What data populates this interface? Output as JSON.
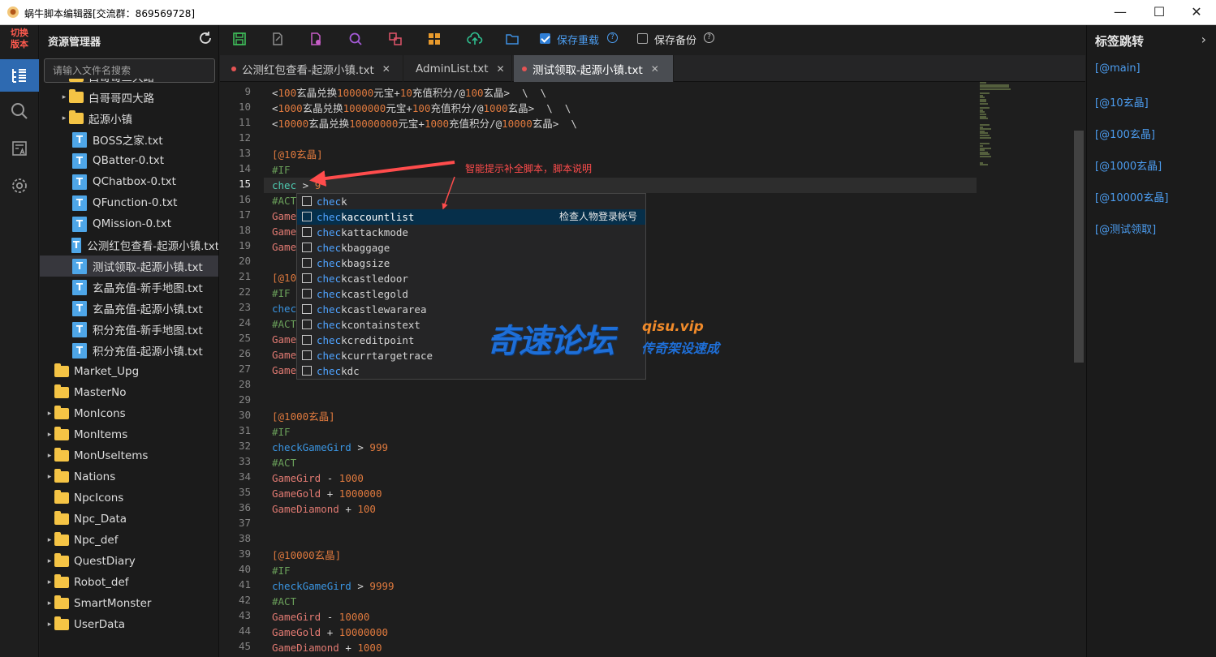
{
  "window": {
    "title": "蜗牛脚本编辑器[交流群：869569728]",
    "minimize": "—",
    "maximize": "☐",
    "close": "✕"
  },
  "activity": {
    "switch_label_1": "切换",
    "switch_label_2": "版本"
  },
  "sidebar": {
    "title": "资源管理器",
    "search_placeholder": "请输入文件名搜索",
    "tree": [
      {
        "label": "白哥哥三大路",
        "type": "folder",
        "arrow": "▸",
        "indent": 1
      },
      {
        "label": "白哥哥四大路",
        "type": "folder",
        "arrow": "▸",
        "indent": 1
      },
      {
        "label": "起源小镇",
        "type": "folder",
        "arrow": "▸",
        "indent": 1
      },
      {
        "label": "BOSS之家.txt",
        "type": "file",
        "arrow": "",
        "indent": 2
      },
      {
        "label": "QBatter-0.txt",
        "type": "file",
        "arrow": "",
        "indent": 2
      },
      {
        "label": "QChatbox-0.txt",
        "type": "file",
        "arrow": "",
        "indent": 2
      },
      {
        "label": "QFunction-0.txt",
        "type": "file",
        "arrow": "",
        "indent": 2
      },
      {
        "label": "QMission-0.txt",
        "type": "file",
        "arrow": "",
        "indent": 2
      },
      {
        "label": "公测红包查看-起源小镇.txt",
        "type": "file",
        "arrow": "",
        "indent": 2
      },
      {
        "label": "测试领取-起源小镇.txt",
        "type": "file",
        "arrow": "",
        "indent": 2,
        "selected": true
      },
      {
        "label": "玄晶充值-新手地图.txt",
        "type": "file",
        "arrow": "",
        "indent": 2
      },
      {
        "label": "玄晶充值-起源小镇.txt",
        "type": "file",
        "arrow": "",
        "indent": 2
      },
      {
        "label": "积分充值-新手地图.txt",
        "type": "file",
        "arrow": "",
        "indent": 2
      },
      {
        "label": "积分充值-起源小镇.txt",
        "type": "file",
        "arrow": "",
        "indent": 2
      },
      {
        "label": "Market_Upg",
        "type": "folder",
        "arrow": "",
        "indent": 0
      },
      {
        "label": "MasterNo",
        "type": "folder",
        "arrow": "",
        "indent": 0
      },
      {
        "label": "MonIcons",
        "type": "folder",
        "arrow": "▸",
        "indent": 0
      },
      {
        "label": "MonItems",
        "type": "folder",
        "arrow": "▸",
        "indent": 0
      },
      {
        "label": "MonUseItems",
        "type": "folder",
        "arrow": "▸",
        "indent": 0
      },
      {
        "label": "Nations",
        "type": "folder",
        "arrow": "▸",
        "indent": 0
      },
      {
        "label": "NpcIcons",
        "type": "folder",
        "arrow": "",
        "indent": 0
      },
      {
        "label": "Npc_Data",
        "type": "folder",
        "arrow": "",
        "indent": 0
      },
      {
        "label": "Npc_def",
        "type": "folder",
        "arrow": "▸",
        "indent": 0
      },
      {
        "label": "QuestDiary",
        "type": "folder",
        "arrow": "▸",
        "indent": 0
      },
      {
        "label": "Robot_def",
        "type": "folder",
        "arrow": "▸",
        "indent": 0
      },
      {
        "label": "SmartMonster",
        "type": "folder",
        "arrow": "▸",
        "indent": 0
      },
      {
        "label": "UserData",
        "type": "folder",
        "arrow": "▸",
        "indent": 0
      }
    ]
  },
  "toolbar": {
    "save_reload_label": "保存重载",
    "save_reload_checked": true,
    "save_backup_label": "保存备份",
    "save_backup_checked": false,
    "help_glyph": "?"
  },
  "tabs": [
    {
      "label": "公测红包查看-起源小镇.txt",
      "modified": true,
      "active": false,
      "close": "✕"
    },
    {
      "label": "AdminList.txt",
      "modified": false,
      "active": false,
      "close": "✕"
    },
    {
      "label": "测试领取-起源小镇.txt",
      "modified": true,
      "active": true,
      "close": "✕"
    }
  ],
  "editor": {
    "current_line": 15,
    "lines": [
      {
        "n": 9,
        "tokens": [
          [
            "w",
            "<"
          ],
          [
            "n",
            "100"
          ],
          [
            "w",
            "玄晶兑换"
          ],
          [
            "n",
            "100000"
          ],
          [
            "w",
            "元宝+"
          ],
          [
            "n",
            "10"
          ],
          [
            "w",
            "充值积分/@"
          ],
          [
            "n",
            "100"
          ],
          [
            "w",
            "玄晶>  \\  \\"
          ]
        ]
      },
      {
        "n": 10,
        "tokens": [
          [
            "w",
            "<"
          ],
          [
            "n",
            "1000"
          ],
          [
            "w",
            "玄晶兑换"
          ],
          [
            "n",
            "1000000"
          ],
          [
            "w",
            "元宝+"
          ],
          [
            "n",
            "100"
          ],
          [
            "w",
            "充值积分/@"
          ],
          [
            "n",
            "1000"
          ],
          [
            "w",
            "玄晶>  \\  \\"
          ]
        ]
      },
      {
        "n": 11,
        "tokens": [
          [
            "w",
            "<"
          ],
          [
            "n",
            "10000"
          ],
          [
            "w",
            "玄晶兑换"
          ],
          [
            "n",
            "10000000"
          ],
          [
            "w",
            "元宝+"
          ],
          [
            "n",
            "1000"
          ],
          [
            "w",
            "充值积分/@"
          ],
          [
            "n",
            "10000"
          ],
          [
            "w",
            "玄晶>  \\"
          ]
        ]
      },
      {
        "n": 12,
        "tokens": []
      },
      {
        "n": 13,
        "tokens": [
          [
            "lbl",
            "[@10玄晶]"
          ]
        ]
      },
      {
        "n": 14,
        "tokens": [
          [
            "kw",
            "#IF"
          ]
        ]
      },
      {
        "n": 15,
        "tokens": [
          [
            "typed",
            "chec"
          ],
          [
            "op",
            " > "
          ],
          [
            "n",
            "9"
          ]
        ]
      },
      {
        "n": 16,
        "tokens": [
          [
            "kw",
            "#ACT"
          ]
        ]
      },
      {
        "n": 17,
        "tokens": [
          [
            "var",
            "Game"
          ]
        ]
      },
      {
        "n": 18,
        "tokens": [
          [
            "var",
            "Game"
          ]
        ]
      },
      {
        "n": 19,
        "tokens": [
          [
            "var",
            "Game"
          ]
        ]
      },
      {
        "n": 20,
        "tokens": []
      },
      {
        "n": 21,
        "tokens": [
          [
            "lbl",
            "[@10"
          ]
        ]
      },
      {
        "n": 22,
        "tokens": [
          [
            "kw",
            "#IF"
          ]
        ]
      },
      {
        "n": 23,
        "tokens": [
          [
            "fn",
            "chec"
          ]
        ]
      },
      {
        "n": 24,
        "tokens": [
          [
            "kw",
            "#ACT"
          ]
        ]
      },
      {
        "n": 25,
        "tokens": [
          [
            "var",
            "Game"
          ]
        ]
      },
      {
        "n": 26,
        "tokens": [
          [
            "var",
            "Game"
          ]
        ]
      },
      {
        "n": 27,
        "tokens": [
          [
            "var",
            "Game"
          ]
        ]
      },
      {
        "n": 28,
        "tokens": []
      },
      {
        "n": 29,
        "tokens": []
      },
      {
        "n": 30,
        "tokens": [
          [
            "lbl",
            "[@1000玄晶]"
          ]
        ]
      },
      {
        "n": 31,
        "tokens": [
          [
            "kw",
            "#IF"
          ]
        ]
      },
      {
        "n": 32,
        "tokens": [
          [
            "fn",
            "checkGameGird"
          ],
          [
            "op",
            " > "
          ],
          [
            "n",
            "999"
          ]
        ]
      },
      {
        "n": 33,
        "tokens": [
          [
            "kw",
            "#ACT"
          ]
        ]
      },
      {
        "n": 34,
        "tokens": [
          [
            "var",
            "GameGird"
          ],
          [
            "op",
            " - "
          ],
          [
            "n",
            "1000"
          ]
        ]
      },
      {
        "n": 35,
        "tokens": [
          [
            "var",
            "GameGold"
          ],
          [
            "op",
            " + "
          ],
          [
            "n",
            "1000000"
          ]
        ]
      },
      {
        "n": 36,
        "tokens": [
          [
            "var",
            "GameDiamond"
          ],
          [
            "op",
            " + "
          ],
          [
            "n",
            "100"
          ]
        ]
      },
      {
        "n": 37,
        "tokens": []
      },
      {
        "n": 38,
        "tokens": []
      },
      {
        "n": 39,
        "tokens": [
          [
            "lbl",
            "[@10000玄晶]"
          ]
        ]
      },
      {
        "n": 40,
        "tokens": [
          [
            "kw",
            "#IF"
          ]
        ]
      },
      {
        "n": 41,
        "tokens": [
          [
            "fn",
            "checkGameGird"
          ],
          [
            "op",
            " > "
          ],
          [
            "n",
            "9999"
          ]
        ]
      },
      {
        "n": 42,
        "tokens": [
          [
            "kw",
            "#ACT"
          ]
        ]
      },
      {
        "n": 43,
        "tokens": [
          [
            "var",
            "GameGird"
          ],
          [
            "op",
            " - "
          ],
          [
            "n",
            "10000"
          ]
        ]
      },
      {
        "n": 44,
        "tokens": [
          [
            "var",
            "GameGold"
          ],
          [
            "op",
            " + "
          ],
          [
            "n",
            "10000000"
          ]
        ]
      },
      {
        "n": 45,
        "tokens": [
          [
            "var",
            "GameDiamond"
          ],
          [
            "op",
            " + "
          ],
          [
            "n",
            "1000"
          ]
        ]
      }
    ]
  },
  "suggest": {
    "match": "chec",
    "selected_index": 1,
    "items": [
      {
        "rest": "k",
        "desc": ""
      },
      {
        "rest": "kaccountlist",
        "desc": "检查人物登录帐号"
      },
      {
        "rest": "kattackmode",
        "desc": ""
      },
      {
        "rest": "kbaggage",
        "desc": ""
      },
      {
        "rest": "kbagsize",
        "desc": ""
      },
      {
        "rest": "kcastledoor",
        "desc": ""
      },
      {
        "rest": "kcastlegold",
        "desc": ""
      },
      {
        "rest": "kcastlewararea",
        "desc": ""
      },
      {
        "rest": "kcontainstext",
        "desc": ""
      },
      {
        "rest": "kcreditpoint",
        "desc": ""
      },
      {
        "rest": "kcurrtargetrace",
        "desc": ""
      },
      {
        "rest": "kdc",
        "desc": ""
      }
    ]
  },
  "annotation": {
    "text": "智能提示补全脚本，脚本说明",
    "color": "#ff4c4c"
  },
  "watermark": {
    "cn": "奇速论坛",
    "en": "qisu.vip",
    "sub": "传奇架设速成"
  },
  "rightpanel": {
    "title": "标签跳转",
    "chevron": "›",
    "tags": [
      "[@main]",
      "[@10玄晶]",
      "[@100玄晶]",
      "[@1000玄晶]",
      "[@10000玄晶]",
      "[@测试领取]"
    ]
  },
  "colors": {
    "accent": "#2f7fd7",
    "link": "#4c9df0",
    "folder": "#f5c445",
    "file": "#4ea6e8"
  }
}
